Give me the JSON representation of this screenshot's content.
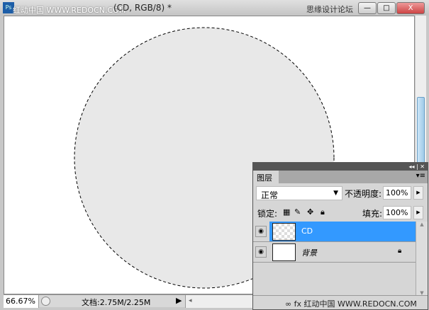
{
  "window": {
    "app_icon": "Ps",
    "watermark_left": "红动中国 WWW.REDOCN.COM",
    "title": "(CD, RGB/8) *",
    "watermark_right": "思缘设计论坛 WWW.MISSYUAN.COM",
    "minimize": "—",
    "maximize": "□",
    "close": "X"
  },
  "status": {
    "zoom": "66.67%",
    "doc_info": "文档:2.75M/2.25M",
    "arrow": "▶",
    "scroll_left": "◂"
  },
  "panel": {
    "collapse": "◂◂ | ✕",
    "tab": "图层",
    "menu": "▾≡",
    "blend_mode": "正常",
    "opacity_label": "不透明度:",
    "opacity": "100%",
    "lock_label": "锁定:",
    "fill_label": "填充:",
    "fill": "100%",
    "layers": [
      {
        "name": "CD",
        "selected": true
      },
      {
        "name": "背景",
        "selected": false,
        "locked": true
      }
    ],
    "footer": "∞  fx 红动中国 WWW.REDOCN.COM"
  }
}
